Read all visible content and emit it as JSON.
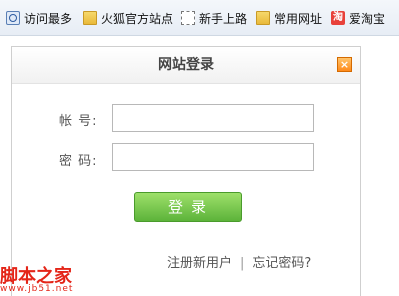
{
  "bookmarks": [
    {
      "label": "访问最多",
      "icon": "search-icon"
    },
    {
      "label": "火狐官方站点",
      "icon": "folder-icon"
    },
    {
      "label": "新手上路",
      "icon": "dashed-page-icon"
    },
    {
      "label": "常用网址",
      "icon": "folder-icon"
    },
    {
      "label": "爱淘宝",
      "icon": "taobao-icon",
      "icon_text": "淘"
    }
  ],
  "dialog": {
    "title": "网站登录",
    "close_symbol": "×",
    "account_label": "帐 号:",
    "account_value": "",
    "password_label": "密 码:",
    "password_value": "",
    "login_label": "登录",
    "register_link": "注册新用户",
    "separator": "|",
    "forgot_link": "忘记密码?"
  },
  "watermark": {
    "name": "脚本之家",
    "url": "www.jb51.net"
  },
  "colors": {
    "login_button": "#6cc248",
    "close_button": "#ff9a2e",
    "watermark": "#e42518"
  }
}
